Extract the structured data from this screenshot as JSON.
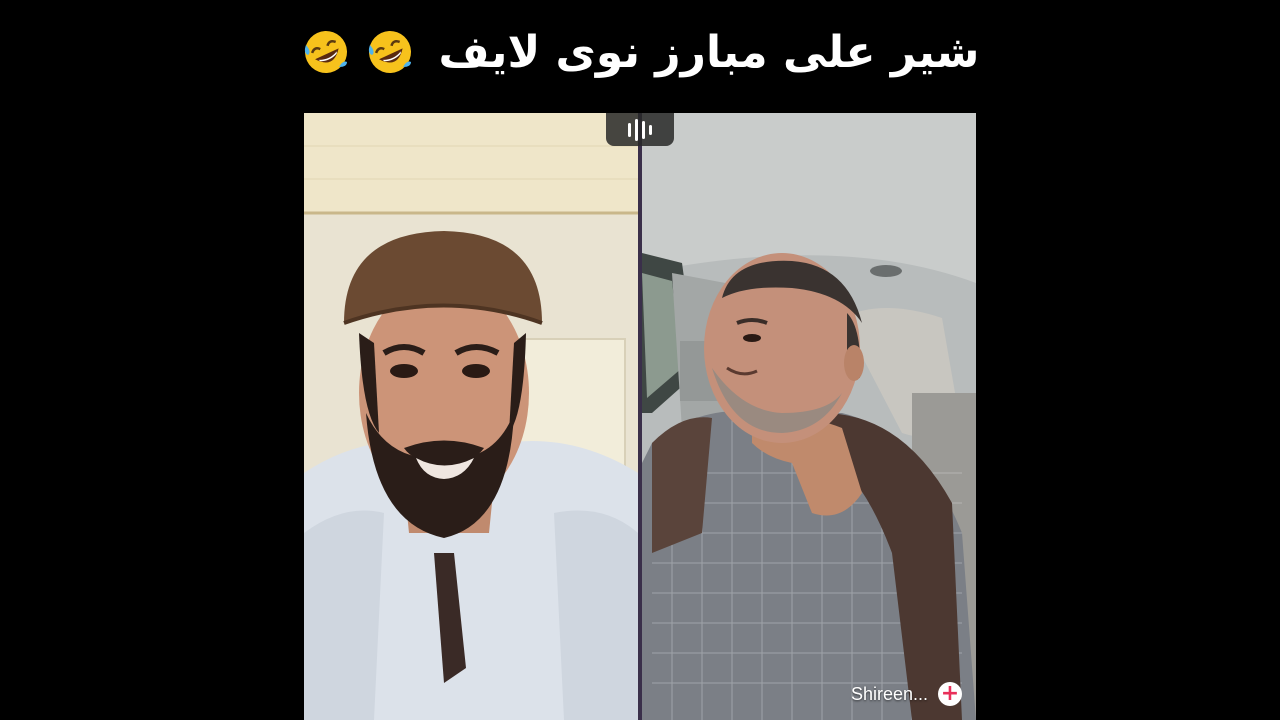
{
  "video": {
    "title": "شیر علی مبارز نوی لایف",
    "title_emojis": [
      "rolling-on-floor-laughing-icon",
      "rolling-on-floor-laughing-icon"
    ],
    "accent_color": "#e8305a"
  },
  "live": {
    "guest_name": "Shireen...",
    "follow_icon": "plus-icon",
    "audio_icon": "audio-waveform-icon"
  }
}
